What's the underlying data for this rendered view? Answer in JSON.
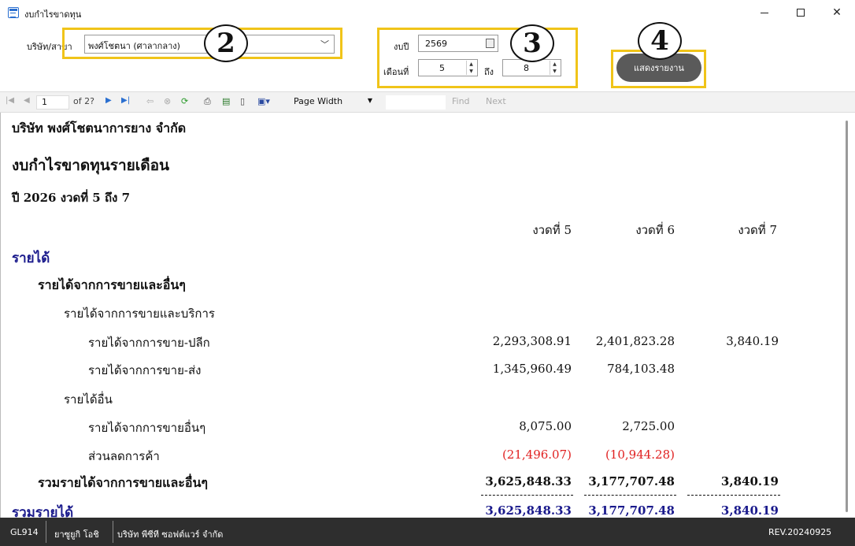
{
  "window": {
    "title": "งบกำไรขาดทุน",
    "icon": "table-icon"
  },
  "filter": {
    "company_label": "บริษัท/สาขา",
    "company_value": "พงศ์โชตนา (ศาลากลาง)",
    "year_label": "งบปี",
    "year_value": "2569",
    "month_label": "เดือนที่",
    "month_from": "5",
    "to_label": "ถึง",
    "month_to": "8",
    "show_button": "แสดงรายงาน",
    "callouts": [
      "2",
      "3",
      "4"
    ],
    "highlight_color": "#f0c419"
  },
  "toolbar": {
    "page_current": "1",
    "page_of": "of  2?",
    "zoom": "Page Width",
    "find_label": "Find",
    "next_label": "Next"
  },
  "report": {
    "company": "บริษัท พงศ์โชตนาการยาง จำกัด",
    "title": "งบกำไรขาดทุนรายเดือน",
    "period": "ปี 2026  งวดที่ 5 ถึง 7",
    "columns": [
      "งวดที่ 5",
      "งวดที่ 6",
      "งวดที่ 7"
    ],
    "section_revenue": "รายได้",
    "group_sales_other": "รายได้จากการขายและอื่นๆ",
    "subgroup_sales_service": "รายได้จากการขายและบริการ",
    "rows": [
      {
        "label": "รายได้จากการขาย-ปลีก",
        "values": [
          "2,293,308.91",
          "2,401,823.28",
          "3,840.19"
        ]
      },
      {
        "label": "รายได้จากการขาย-ส่ง",
        "values": [
          "1,345,960.49",
          "784,103.48",
          ""
        ]
      }
    ],
    "subgroup_other": "รายได้อื่น",
    "rows_other": [
      {
        "label": "รายได้จากการขายอื่นๆ",
        "values": [
          "8,075.00",
          "2,725.00",
          ""
        ]
      },
      {
        "label": "ส่วนลดการค้า",
        "values": [
          "(21,496.07)",
          "(10,944.28)",
          ""
        ]
      }
    ],
    "total_sales_other": {
      "label": "รวมรายได้จากการขายและอื่นๆ",
      "values": [
        "3,625,848.33",
        "3,177,707.48",
        "3,840.19"
      ]
    },
    "total_revenue": {
      "label": "รวมรายได้",
      "values": [
        "3,625,848.33",
        "3,177,707.48",
        "3,840.19"
      ]
    },
    "colors": {
      "navy": "#1a1a8c",
      "negative": "#e02020"
    }
  },
  "status": {
    "code": "GL914",
    "user": "ยาซูยูกิ  โอชิ",
    "company": "บริษัท พีซีที ซอฟต์แวร์ จำกัด",
    "version": "REV.20240925"
  }
}
